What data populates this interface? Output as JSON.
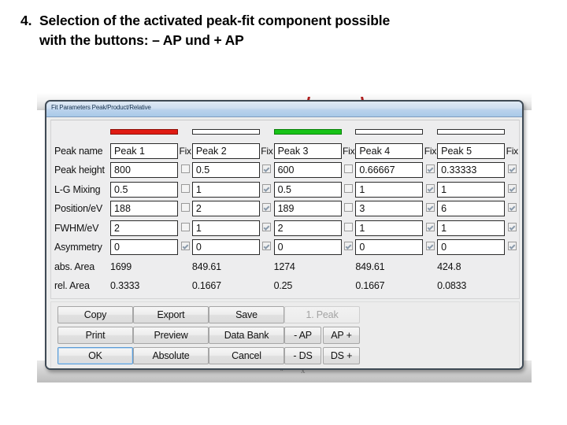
{
  "slide": {
    "number": "4.",
    "line1": "Selection of the activated peak-fit component possible",
    "line2": "with the buttons: – AP und + AP"
  },
  "dialog": {
    "title": "Fit Parameters Peak/Product/Relative",
    "fix_header": "Fix",
    "row_labels": {
      "peak_name": "Peak name",
      "peak_height": "Peak height",
      "lg_mixing": "L-G Mixing",
      "position": "Position/eV",
      "fwhm": "FWHM/eV",
      "asymmetry": "Asymmetry",
      "abs_area": "abs. Area",
      "rel_area": "rel. Area"
    },
    "colors": {
      "peak1_swatch": "#e01b13",
      "peak2_swatch": "#ffffff",
      "peak3_swatch": "#18c318",
      "peak4_swatch": "#ffffff",
      "peak5_swatch": "#ffffff"
    },
    "columns": [
      {
        "name": "Peak 1",
        "swatch": "red",
        "peak_height": "800",
        "lg_mixing": "0.5",
        "position": "188",
        "fwhm": "2",
        "asymmetry": "0",
        "abs_area": "1699",
        "rel_area": "0.3333",
        "fix": [
          false,
          false,
          false,
          false,
          true
        ]
      },
      {
        "name": "Peak 2",
        "swatch": "white",
        "peak_height": "0.5",
        "lg_mixing": "1",
        "position": "2",
        "fwhm": "1",
        "asymmetry": "0",
        "abs_area": "849.61",
        "rel_area": "0.1667",
        "fix": [
          true,
          true,
          true,
          true,
          true
        ]
      },
      {
        "name": "Peak 3",
        "swatch": "green",
        "peak_height": "600",
        "lg_mixing": "0.5",
        "position": "189",
        "fwhm": "2",
        "asymmetry": "0",
        "abs_area": "1274",
        "rel_area": "0.25",
        "fix": [
          false,
          false,
          false,
          false,
          true
        ]
      },
      {
        "name": "Peak 4",
        "swatch": "white",
        "peak_height": "0.66667",
        "lg_mixing": "1",
        "position": "3",
        "fwhm": "1",
        "asymmetry": "0",
        "abs_area": "849.61",
        "rel_area": "0.1667",
        "fix": [
          true,
          true,
          true,
          true,
          true
        ]
      },
      {
        "name": "Peak 5",
        "swatch": "white",
        "peak_height": "0.33333",
        "lg_mixing": "1",
        "position": "6",
        "fwhm": "1",
        "asymmetry": "0",
        "abs_area": "424.8",
        "rel_area": "0.0833",
        "fix": [
          true,
          true,
          true,
          true,
          true
        ]
      }
    ],
    "buttons": {
      "copy": "Copy",
      "export": "Export",
      "save": "Save",
      "peak_indicator": "1. Peak",
      "print": "Print",
      "preview": "Preview",
      "data_bank": "Data Bank",
      "ap_minus": "- AP",
      "ap_plus": "AP +",
      "ok": "OK",
      "absolute": "Absolute",
      "cancel": "Cancel",
      "ds_minus": "- DS",
      "ds_plus": "DS +"
    }
  }
}
